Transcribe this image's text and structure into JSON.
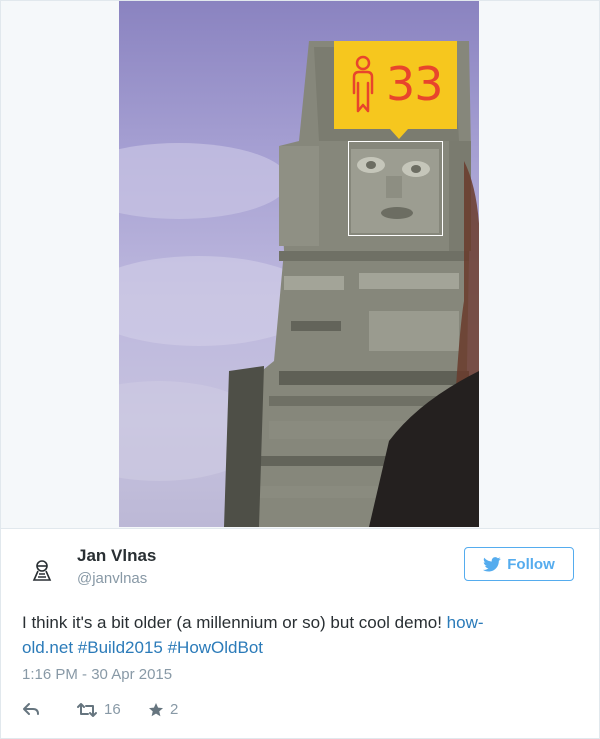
{
  "image": {
    "age_badge": {
      "age": "33",
      "color": "#f6c71e",
      "number_color": "#e8452c"
    }
  },
  "tweet": {
    "author_name": "Jan Vlnas",
    "author_handle": "@janvlnas",
    "follow_label": "Follow",
    "text_plain": "I think it's a bit older (a millennium or so) but cool demo! ",
    "link_1": "how-",
    "link_2": "old.net",
    "hashtag_1": "#Build2015",
    "hashtag_2": "#HowOldBot",
    "timestamp": "1:16 PM - 30 Apr 2015",
    "retweet_count": "16",
    "favorite_count": "2"
  },
  "colors": {
    "link": "#2b7bb9",
    "twitter_blue": "#55acee",
    "muted": "#8899a6",
    "text": "#292f33"
  },
  "icons": [
    "reply-icon",
    "retweet-icon",
    "star-icon",
    "twitter-bird-icon",
    "avatar-icon",
    "person-icon"
  ]
}
